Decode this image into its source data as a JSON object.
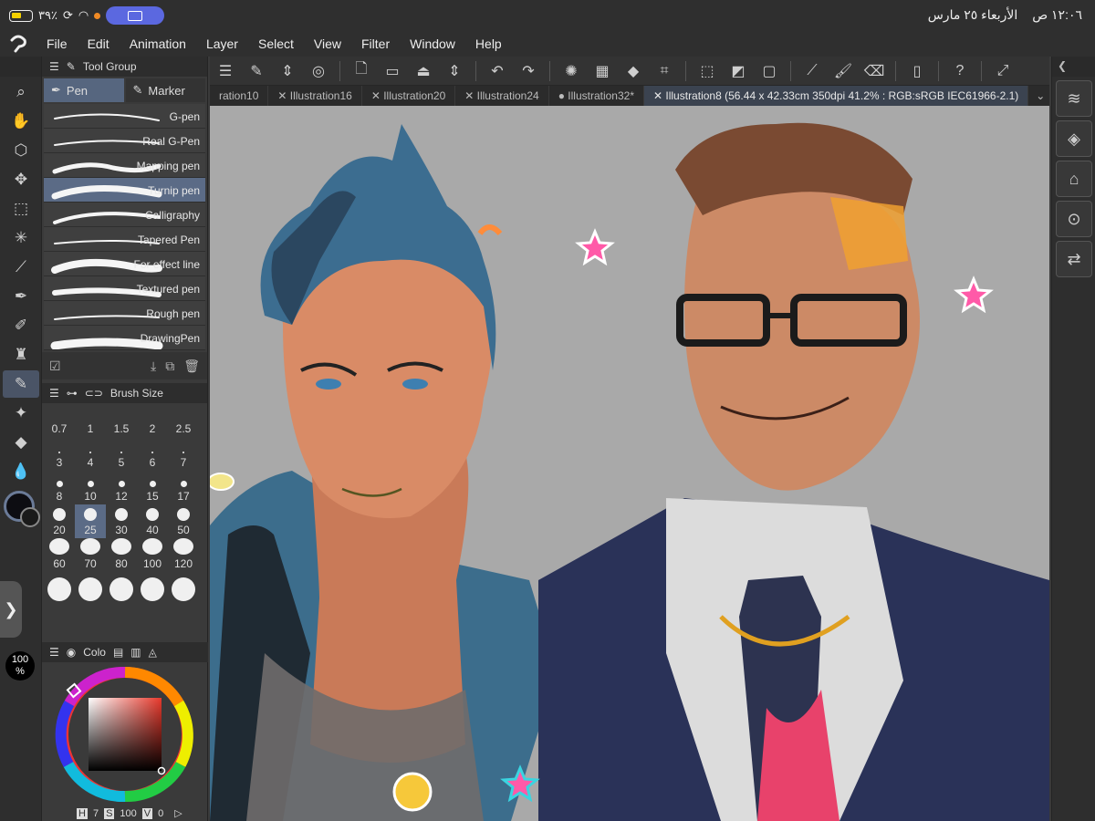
{
  "status": {
    "battery": "٣٩٪",
    "time": "١٢:٠٦ ص",
    "date": "الأربعاء ٢٥ مارس"
  },
  "menu": [
    "File",
    "Edit",
    "Animation",
    "Layer",
    "Select",
    "View",
    "Filter",
    "Window",
    "Help"
  ],
  "tabs": [
    {
      "label": "ration10"
    },
    {
      "label": "Illustration16"
    },
    {
      "label": "Illustration20"
    },
    {
      "label": "Illustration24"
    },
    {
      "label": "Illustration32*"
    },
    {
      "label": "Illustration8 (56.44 x 42.33cm 350dpi 41.2% : RGB:sRGB IEC61966-2.1)"
    }
  ],
  "subtool": {
    "header": "Tool Group",
    "tab_pen": "Pen",
    "tab_marker": "Marker",
    "brushes": [
      "G-pen",
      "Real G-Pen",
      "Mapping pen",
      "Turnip pen",
      "Calligraphy",
      "Tapered Pen",
      "For effect line",
      "Textured pen",
      "Rough pen",
      "DrawingPen"
    ],
    "selected_brush": "Turnip pen"
  },
  "brush_size": {
    "header": "Brush Size",
    "sizes": [
      "0.7",
      "1",
      "1.5",
      "2",
      "2.5",
      "3",
      "4",
      "5",
      "6",
      "7",
      "8",
      "10",
      "12",
      "15",
      "17",
      "20",
      "25",
      "30",
      "40",
      "50",
      "60",
      "70",
      "80",
      "100",
      "120"
    ],
    "selected": "25"
  },
  "color": {
    "header": "Colo",
    "h_label": "H",
    "h_value": "7",
    "s_label": "S",
    "s_value": "100",
    "v_label": "V",
    "v_value": "0",
    "main_color": "#0d0d12",
    "picker_hue": "#e8392c"
  },
  "zoom_badge": "100\n%",
  "accent": "#5b6b86"
}
